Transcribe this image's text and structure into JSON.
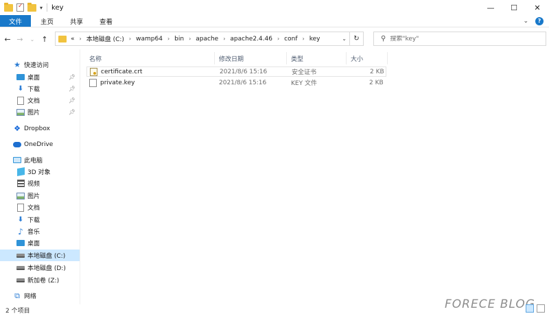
{
  "window": {
    "title": "key",
    "controls": [
      "minimize",
      "maximize",
      "close"
    ]
  },
  "ribbon": {
    "tabs": [
      "文件",
      "主页",
      "共享",
      "查看"
    ]
  },
  "address": {
    "prefix": "«",
    "crumbs": [
      "本地磁盘 (C:)",
      "wamp64",
      "bin",
      "apache",
      "apache2.4.46",
      "conf",
      "key"
    ]
  },
  "search": {
    "placeholder": "搜索\"key\""
  },
  "sidebar": {
    "quick_access": "快速访问",
    "pinned": [
      "桌面",
      "下载",
      "文档",
      "图片"
    ],
    "dropbox": "Dropbox",
    "onedrive": "OneDrive",
    "this_pc": "此电脑",
    "pc_items": [
      "3D 对象",
      "视频",
      "图片",
      "文档",
      "下载",
      "音乐",
      "桌面"
    ],
    "drives": [
      "本地磁盘 (C:)",
      "本地磁盘 (D:)",
      "新加卷 (Z:)"
    ],
    "network": "网络",
    "selected": "本地磁盘 (C:)"
  },
  "columns": {
    "name": "名称",
    "date": "修改日期",
    "type": "类型",
    "size": "大小"
  },
  "files": [
    {
      "name": "certificate.crt",
      "date": "2021/8/6 15:16",
      "type": "安全证书",
      "size": "2 KB",
      "icon": "certificate-icon"
    },
    {
      "name": "private.key",
      "date": "2021/8/6 15:16",
      "type": "KEY 文件",
      "size": "2 KB",
      "icon": "file-icon"
    }
  ],
  "status": {
    "count": "2 个项目"
  },
  "watermark": "FORECE BLOG"
}
